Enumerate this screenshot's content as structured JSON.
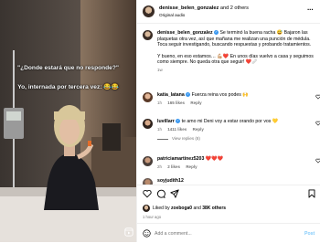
{
  "media": {
    "overlay_line_1": "\"¿Donde estará que no responde?\"",
    "overlay_line_2": "Yo, internada por tercera vez: 😂😂"
  },
  "header": {
    "username": "denisse_belen_gonzalez",
    "coauthors": "and 2 others",
    "subtitle": "Original audio",
    "more_icon": "more-horizontal-icon"
  },
  "caption": {
    "username": "denisse_belen_gonzalez",
    "verified": "✓",
    "text": "Se terminó la buena racha 😅 Bajaron las plaquetas otra vez, así que mañana me realizan una punción de médula. Toca seguir investigando, buscando respuestas y probando tratamientos.",
    "text2": "Y bueno, en eso estamos… 💪🏼❤️ En unos días vuelvo a casa y seguimos como siempre. No queda otra que seguir! ❤️🩹",
    "time": "1w"
  },
  "comments": [
    {
      "username": "katia_latana",
      "verified": "✓",
      "text": "Fuerza reina vos podes 🙌",
      "time": "1h",
      "likes": "165 likes",
      "reply": "Reply"
    },
    {
      "username": "luvillarr",
      "verified": "✓",
      "text": "te amo mi Deni voy a estar orando por vos 💛",
      "time": "1h",
      "likes": "1411 likes",
      "reply": "Reply",
      "view_replies": "View replies (8)"
    },
    {
      "username": "patriciamartinez5203",
      "text": "❤️❤️❤️",
      "time": "2h",
      "likes": "2 likes",
      "reply": "Reply"
    },
    {
      "username": "soyjudith12",
      "text": "",
      "time": "",
      "likes": "",
      "reply": ""
    }
  ],
  "footer": {
    "liked_by_prefix": "Liked by ",
    "liked_by_user": "zoeboga0",
    "liked_by_and": " and ",
    "liked_by_count": "38K others",
    "time_ago": "1 hour ago",
    "comment_placeholder": "Add a comment...",
    "post_label": "Post",
    "post_color": "#0095f6"
  }
}
